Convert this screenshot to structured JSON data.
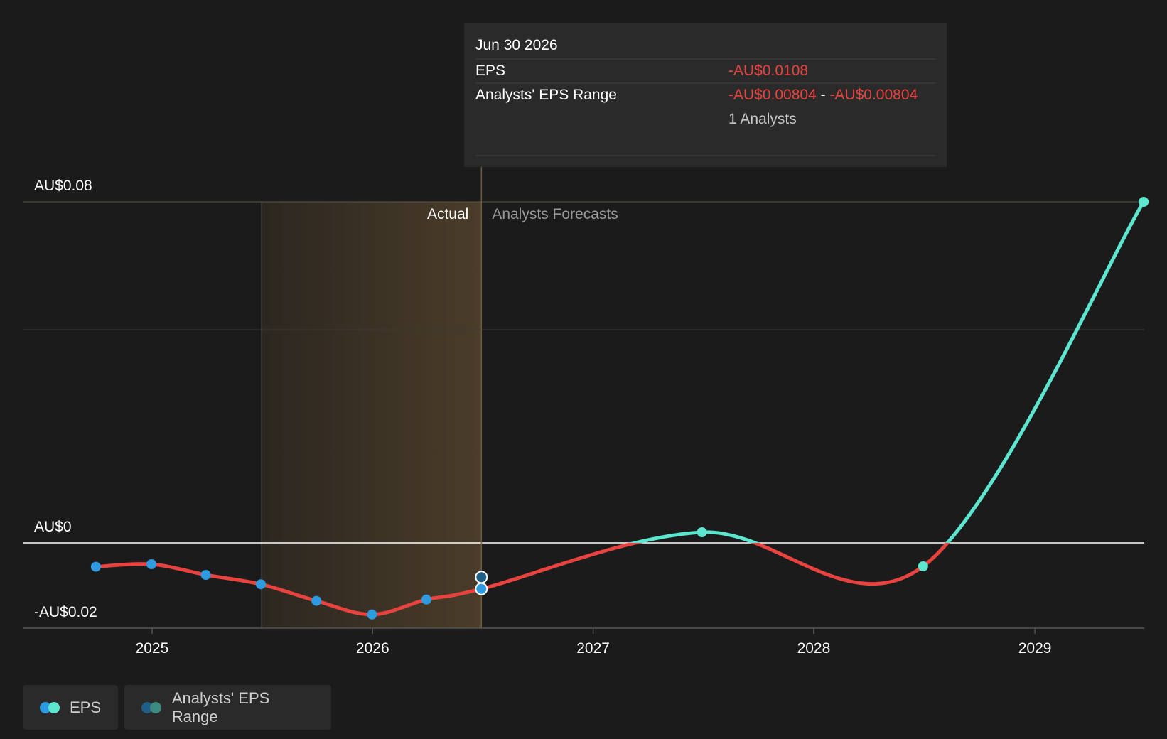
{
  "colors": {
    "background": "#1b1b1b",
    "eps_actual": "#2e9be0",
    "eps_forecast_positive": "#5ce6d0",
    "eps_negative": "#e8433f",
    "actual_shade": "#4a3c29",
    "tooltip_bg": "#2a2a2a",
    "axis_text": "#ffffff",
    "muted_text": "#9a9a9a",
    "gridline": "#3a3a3a"
  },
  "tooltip": {
    "date": "Jun 30 2026",
    "rows": [
      {
        "label": "EPS",
        "value": "-AU$0.0108"
      },
      {
        "label": "Analysts' EPS Range",
        "value_low": "-AU$0.00804",
        "separator": " - ",
        "value_high": "-AU$0.00804"
      }
    ],
    "analysts": "1 Analysts"
  },
  "regions": {
    "actual_label": "Actual",
    "forecast_label": "Analysts Forecasts"
  },
  "legend": {
    "eps_label": "EPS",
    "range_label": "Analysts' EPS Range"
  },
  "chart_data": {
    "type": "line",
    "y_tick_labels": [
      "AU$0.08",
      "AU$0",
      "-AU$0.02"
    ],
    "y_ticks": [
      0.08,
      0,
      -0.02
    ],
    "ylim": [
      -0.02,
      0.08
    ],
    "xlim": [
      "2024-06-01",
      "2029-07-01"
    ],
    "x_tick_labels": [
      "2025",
      "2026",
      "2027",
      "2028",
      "2029"
    ],
    "x_ticks": [
      "2025-01-01",
      "2026-01-01",
      "2027-01-01",
      "2028-01-01",
      "2029-01-01"
    ],
    "actual_shade_range": [
      "2025-07-01",
      "2026-06-30"
    ],
    "forecast_start": "2026-06-30",
    "grid": true,
    "legend_position": "bottom-left",
    "series": [
      {
        "name": "EPS",
        "values": [
          {
            "date": "2024-09-30",
            "eps": -0.0056
          },
          {
            "date": "2024-12-31",
            "eps": -0.005
          },
          {
            "date": "2025-03-31",
            "eps": -0.0075
          },
          {
            "date": "2025-06-30",
            "eps": -0.0097
          },
          {
            "date": "2025-09-30",
            "eps": -0.0136
          },
          {
            "date": "2025-12-31",
            "eps": -0.0168
          },
          {
            "date": "2026-03-31",
            "eps": -0.0133
          },
          {
            "date": "2026-06-30",
            "eps": -0.0108
          },
          {
            "date": "2027-06-30",
            "eps": 0.0025
          },
          {
            "date": "2028-06-30",
            "eps": -0.0055
          },
          {
            "date": "2029-06-30",
            "eps": 0.08
          }
        ]
      }
    ],
    "analyst_range": {
      "date": "2026-06-30",
      "low": -0.00804,
      "high": -0.00804
    }
  }
}
